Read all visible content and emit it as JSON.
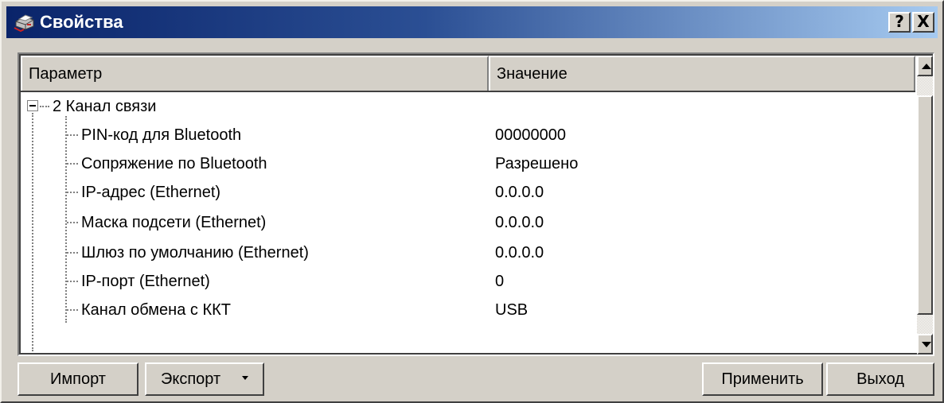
{
  "window": {
    "title": "Свойства"
  },
  "titlebar_buttons": {
    "help": "?",
    "close": "X"
  },
  "columns": {
    "param": "Параметр",
    "value": "Значение"
  },
  "tree": {
    "group": {
      "label": "2 Канал связи",
      "expanded": true
    },
    "items": [
      {
        "param": "PIN-код для Bluetooth",
        "value": "00000000"
      },
      {
        "param": "Сопряжение по Bluetooth",
        "value": "Разрешено"
      },
      {
        "param": "IP-адрес (Ethernet)",
        "value": "0.0.0.0"
      },
      {
        "param": "Маска подсети (Ethernet)",
        "value": "0.0.0.0"
      },
      {
        "param": "Шлюз по умолчанию (Ethernet)",
        "value": "0.0.0.0"
      },
      {
        "param": "IP-порт (Ethernet)",
        "value": "0"
      },
      {
        "param": "Канал обмена с ККТ",
        "value": "USB"
      }
    ]
  },
  "buttons": {
    "import": "Импорт",
    "export": "Экспорт",
    "apply": "Применить",
    "exit": "Выход"
  },
  "colors": {
    "titlebar_start": "#0a246a",
    "titlebar_end": "#a6caf0",
    "face": "#d4d0c8"
  }
}
